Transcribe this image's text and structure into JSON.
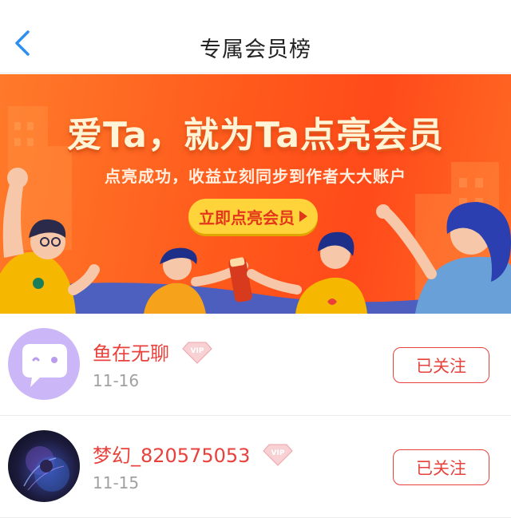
{
  "header": {
    "title": "专属会员榜",
    "back_icon": "chevron-left-icon"
  },
  "banner": {
    "headline": "爱Ta，就为Ta点亮会员",
    "subtitle": "点亮成功，收益立刻同步到作者大大账户",
    "cta_label": "立即点亮会员",
    "colors": {
      "background": "#ff5a1c",
      "cta": "#ffd43b",
      "cta_text": "#e3361a"
    }
  },
  "members": [
    {
      "name": "鱼在无聊",
      "date": "11-16",
      "badge": "VIP",
      "follow_label": "已关注",
      "avatar": "chat-bubble-avatar"
    },
    {
      "name": "梦幻_820575053",
      "date": "11-15",
      "badge": "VIP",
      "follow_label": "已关注",
      "avatar": "photo-avatar"
    }
  ],
  "colors": {
    "accent": "#e8413c",
    "muted": "#a0a0a0",
    "back_icon": "#2f8ff0"
  }
}
